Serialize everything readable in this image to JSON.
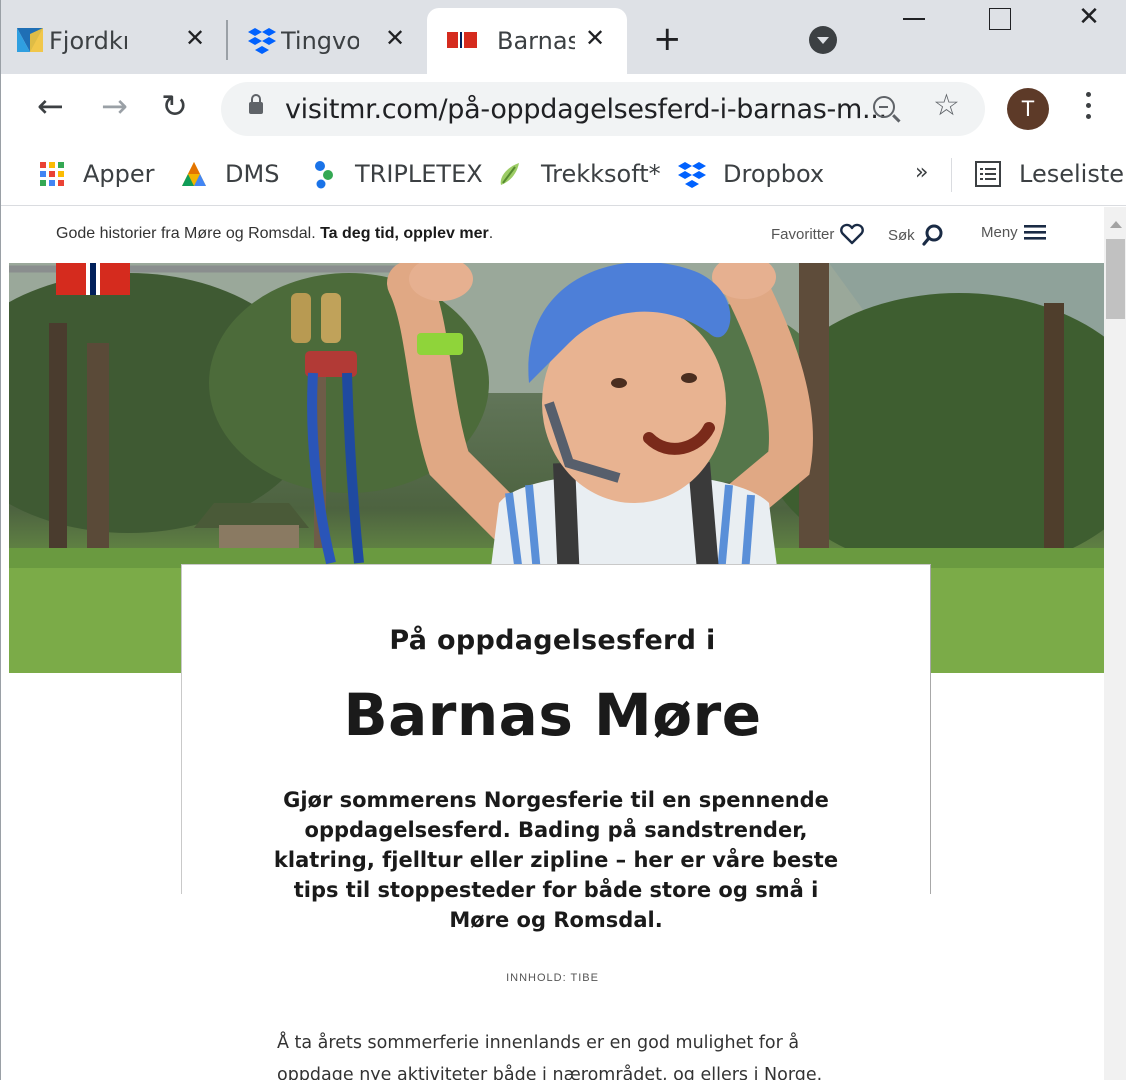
{
  "browser": {
    "tabs": [
      {
        "label": "Fjordkr",
        "close": "✕"
      },
      {
        "label": "Tingvol",
        "close": "✕"
      },
      {
        "label": "Barnas",
        "close": "✕"
      }
    ],
    "new_tab": "+",
    "url": "visitmr.com/på-oppdagelsesferd-i-barnas-m...",
    "avatar_initial": "T",
    "window_close": "✕",
    "bookmarks": [
      {
        "label": "Apper",
        "icon": "apps-grid-icon"
      },
      {
        "label": "DMS",
        "icon": "dms-triangle-icon"
      },
      {
        "label": "TRIPLETEX",
        "icon": "tripletex-icon"
      },
      {
        "label": "Trekksoft*",
        "icon": "trekksoft-icon"
      },
      {
        "label": "Dropbox",
        "icon": "dropbox-icon"
      }
    ],
    "bookmarks_more": "»",
    "reading_list": "Leseliste"
  },
  "site": {
    "tagline_prefix": "Gode historier fra Møre og Romsdal. ",
    "tagline_bold": "Ta deg tid, opplev mer",
    "tagline_suffix": ".",
    "nav": {
      "favorites": "Favoritter",
      "search": "Søk",
      "menu": "Meny"
    }
  },
  "article": {
    "pre_title": "På oppdagelsesferd i",
    "title": "Barnas Møre",
    "lead": "Gjør sommerens Norgesferie til en spennende oppdagelsesferd. Bading på sandstrender, klatring, fjelltur eller zipline – her er våre beste tips til stoppesteder for både store og små i Møre og Romsdal.",
    "credit": "INNHOLD: TIBE",
    "body": "Å ta årets sommerferie innenlands er en god mulighet for å oppdage nye aktiviteter både i nærområdet, og ellers i Norge."
  },
  "colors": {
    "tabstrip": "#dee1e6",
    "flag_red": "#d52b1e",
    "flag_blue": "#00205b",
    "avatar": "#5d3a28"
  }
}
